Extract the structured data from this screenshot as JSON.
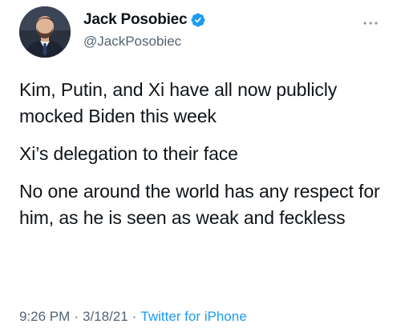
{
  "tweet": {
    "author": {
      "name": "Jack Posobiec",
      "handle": "@JackPosobiec",
      "verified": true,
      "verified_color": "#1d9bf0"
    },
    "more_icon": "more-horizontal-icon",
    "paragraphs": [
      "Kim, Putin, and Xi have all now publicly mocked Biden this week",
      "Xi’s delegation to their face",
      "No one around the world has any respect for him, as he is seen as weak and feckless"
    ],
    "meta": {
      "time": "9:26 PM",
      "separator": "·",
      "date": "3/18/21",
      "source": "Twitter for iPhone"
    }
  },
  "colors": {
    "text_primary": "#0f1419",
    "text_secondary": "#536471",
    "link": "#1d9bf0",
    "background": "#ffffff"
  }
}
